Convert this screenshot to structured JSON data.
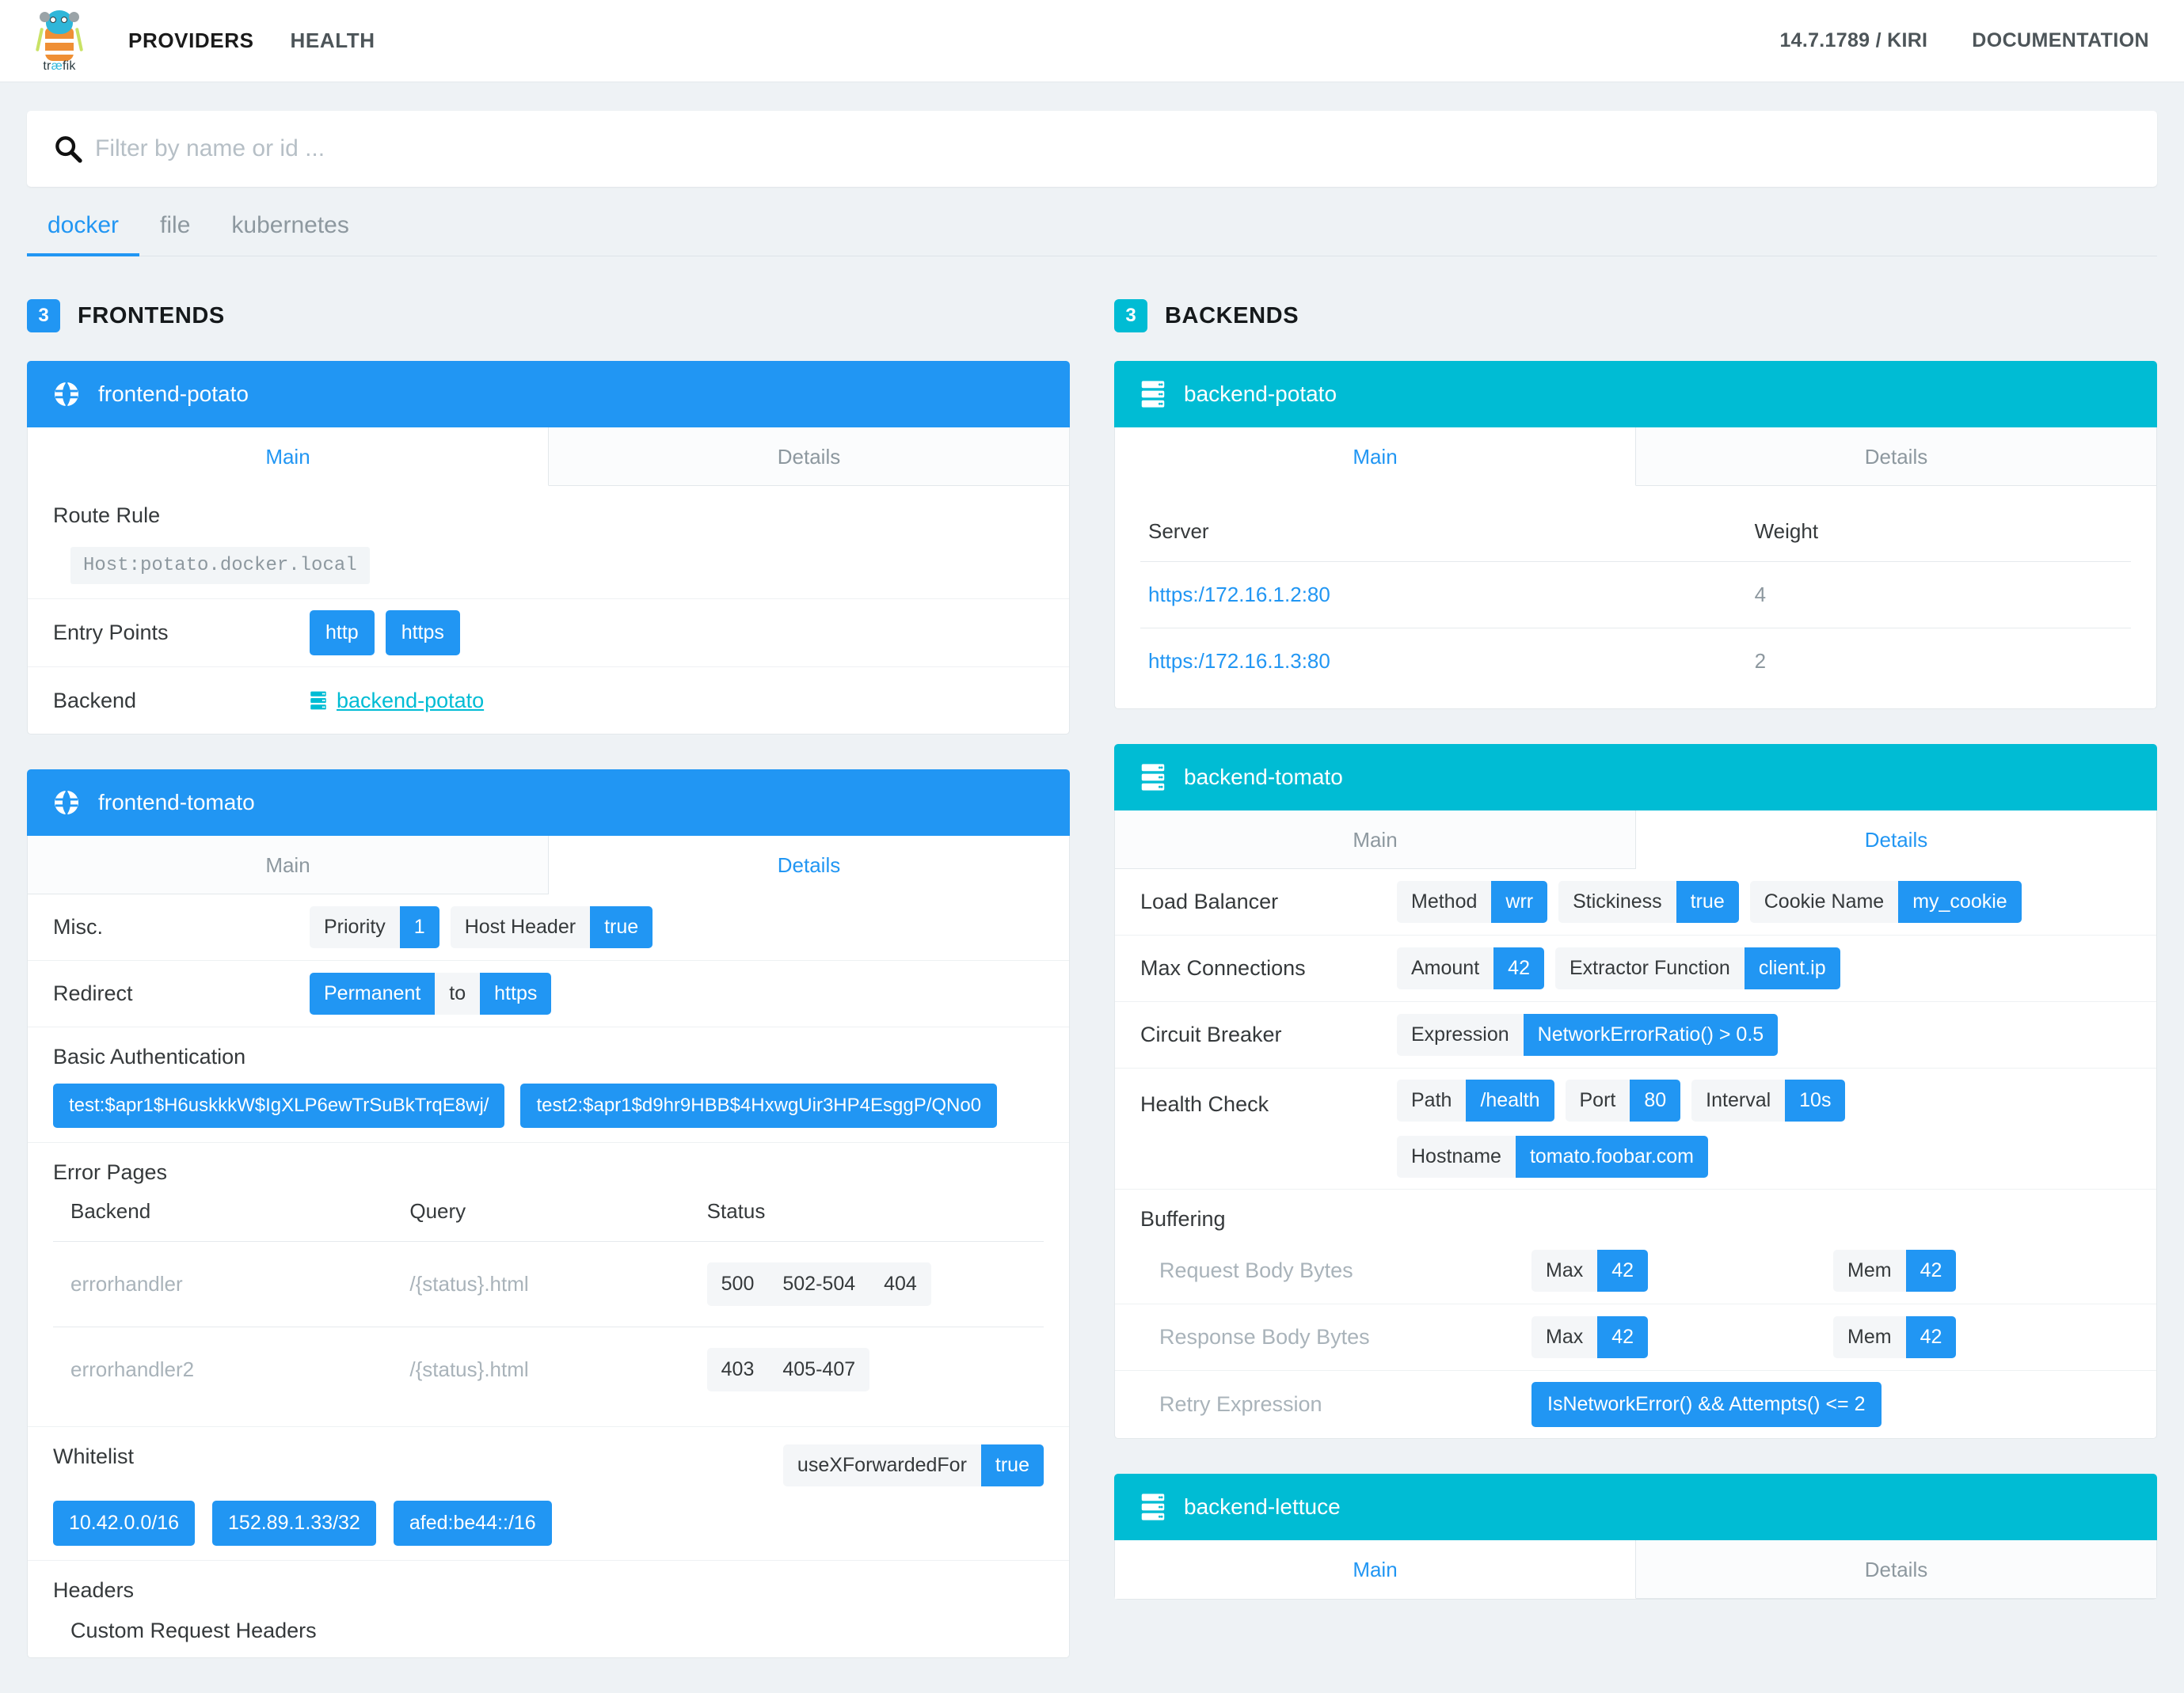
{
  "navbar": {
    "brand": "trafik",
    "brand_prefix": "tr",
    "brand_ae": "æ",
    "brand_suffix": "fik",
    "links": [
      {
        "label": "PROVIDERS",
        "active": true
      },
      {
        "label": "HEALTH",
        "active": false
      }
    ],
    "version": "14.7.1789 / KIRI",
    "documentation": "DOCUMENTATION"
  },
  "search": {
    "placeholder": "Filter by name or id ...",
    "value": "",
    "icon": "search-icon"
  },
  "provider_tabs": [
    {
      "label": "docker",
      "active": true
    },
    {
      "label": "file",
      "active": false
    },
    {
      "label": "kubernetes",
      "active": false
    }
  ],
  "frontends": {
    "count": "3",
    "title": "FRONTENDS",
    "accent": "#2196f3",
    "cards": [
      {
        "name": "frontend-potato",
        "icon": "globe-icon",
        "tabs": [
          {
            "label": "Main",
            "active": true
          },
          {
            "label": "Details",
            "active": false
          }
        ],
        "route_rule_label": "Route Rule",
        "route_rule_value": "Host:potato.docker.local",
        "entry_points_label": "Entry Points",
        "entry_points": [
          "http",
          "https"
        ],
        "backend_label": "Backend",
        "backend_value": "backend-potato"
      },
      {
        "name": "frontend-tomato",
        "icon": "globe-icon",
        "tabs": [
          {
            "label": "Main",
            "active": false
          },
          {
            "label": "Details",
            "active": true
          }
        ],
        "misc_label": "Misc.",
        "misc": [
          {
            "key": "Priority",
            "value": "1"
          },
          {
            "key": "Host Header",
            "value": "true"
          }
        ],
        "redirect_label": "Redirect",
        "redirect_from": "Permanent",
        "redirect_sep": "to",
        "redirect_to": "https",
        "basic_auth_label": "Basic Authentication",
        "basic_auth": [
          "test:$apr1$H6uskkkW$IgXLP6ewTrSuBkTrqE8wj/",
          "test2:$apr1$d9hr9HBB$4HxwgUir3HP4EsggP/QNo0"
        ],
        "error_pages_label": "Error Pages",
        "error_pages_columns": [
          "Backend",
          "Query",
          "Status"
        ],
        "error_pages_rows": [
          {
            "backend": "errorhandler",
            "query": "/{status}.html",
            "status": [
              "500",
              "502-504",
              "404"
            ]
          },
          {
            "backend": "errorhandler2",
            "query": "/{status}.html",
            "status": [
              "403",
              "405-407"
            ]
          }
        ],
        "whitelist_label": "Whitelist",
        "whitelist_flag_key": "useXForwardedFor",
        "whitelist_flag_value": "true",
        "whitelist": [
          "10.42.0.0/16",
          "152.89.1.33/32",
          "afed:be44::/16"
        ],
        "headers_label": "Headers",
        "custom_request_headers_label": "Custom Request Headers"
      }
    ]
  },
  "backends": {
    "count": "3",
    "title": "BACKENDS",
    "accent": "#00bcd4",
    "cards": [
      {
        "name": "backend-potato",
        "icon": "server-icon",
        "tabs": [
          {
            "label": "Main",
            "active": true
          },
          {
            "label": "Details",
            "active": false
          }
        ],
        "columns": [
          "Server",
          "Weight"
        ],
        "servers": [
          {
            "url": "https:/172.16.1.2:80",
            "weight": "4"
          },
          {
            "url": "https:/172.16.1.3:80",
            "weight": "2"
          }
        ]
      },
      {
        "name": "backend-tomato",
        "icon": "server-icon",
        "tabs": [
          {
            "label": "Main",
            "active": false
          },
          {
            "label": "Details",
            "active": true
          }
        ],
        "load_balancer_label": "Load Balancer",
        "load_balancer": [
          {
            "key": "Method",
            "value": "wrr"
          },
          {
            "key": "Stickiness",
            "value": "true"
          },
          {
            "key": "Cookie Name",
            "value": "my_cookie"
          }
        ],
        "max_connections_label": "Max Connections",
        "max_connections": [
          {
            "key": "Amount",
            "value": "42"
          },
          {
            "key": "Extractor Function",
            "value": "client.ip"
          }
        ],
        "circuit_breaker_label": "Circuit Breaker",
        "circuit_breaker": [
          {
            "key": "Expression",
            "value": "NetworkErrorRatio() > 0.5"
          }
        ],
        "health_check_label": "Health Check",
        "health_check": [
          {
            "key": "Path",
            "value": "/health"
          },
          {
            "key": "Port",
            "value": "80"
          },
          {
            "key": "Interval",
            "value": "10s"
          }
        ],
        "health_check_row2": [
          {
            "key": "Hostname",
            "value": "tomato.foobar.com"
          }
        ],
        "buffering_label": "Buffering",
        "request_body_label": "Request Body Bytes",
        "request_body": [
          {
            "key": "Max",
            "value": "42"
          },
          {
            "key": "Mem",
            "value": "42"
          }
        ],
        "response_body_label": "Response Body Bytes",
        "response_body": [
          {
            "key": "Max",
            "value": "42"
          },
          {
            "key": "Mem",
            "value": "42"
          }
        ],
        "retry_expression_label": "Retry Expression",
        "retry_expression_value": "IsNetworkError() && Attempts() <= 2"
      },
      {
        "name": "backend-lettuce",
        "icon": "server-icon",
        "tabs": [
          {
            "label": "Main",
            "active": true
          },
          {
            "label": "Details",
            "active": false
          }
        ]
      }
    ]
  }
}
